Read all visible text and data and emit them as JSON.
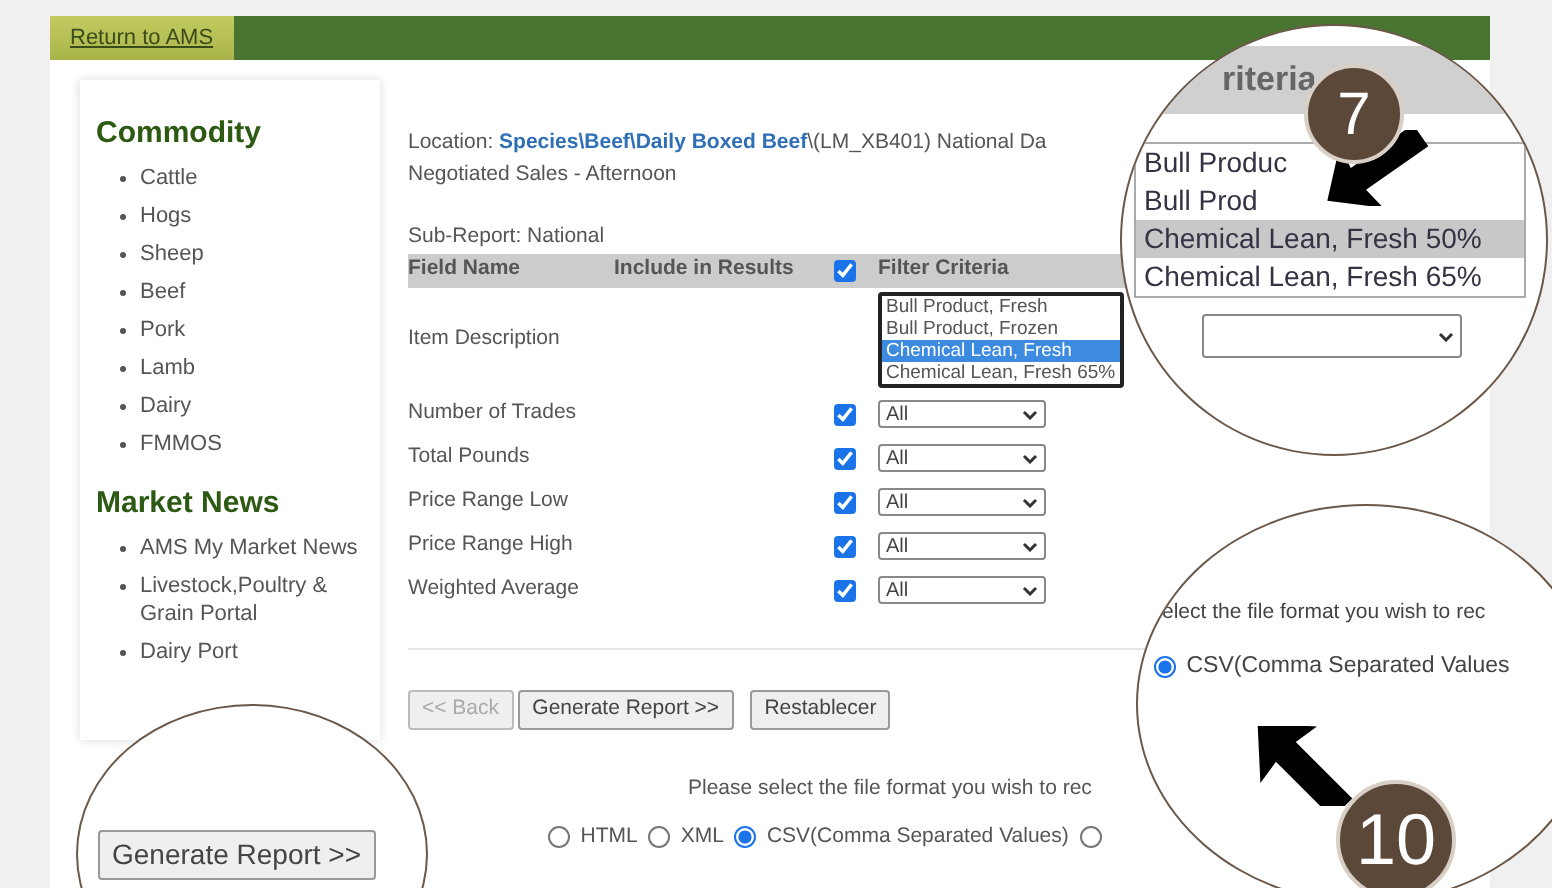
{
  "header": {
    "tab": "Return to AMS"
  },
  "sidebar": {
    "sections": [
      {
        "title": "Commodity",
        "items": [
          "Cattle",
          "Hogs",
          "Sheep",
          "Beef",
          "Pork",
          "Lamb",
          "Dairy",
          "FMMOS"
        ]
      },
      {
        "title": "Market News",
        "items": [
          "AMS My Market News",
          "Livestock,Poultry & Grain Portal",
          "Dairy Port"
        ]
      }
    ]
  },
  "location": {
    "text": "Location: **Species\\Beef\\Daily Boxed Beef**\\(LM_XB401) National Da",
    "line2": "Negotiated Sales - Afternoon"
  },
  "sub_report": "Sub-Report: National",
  "table": {
    "columns": [
      "Field Name",
      "Include in Results",
      "Filter Criteria"
    ],
    "include_all": true,
    "rows": [
      {
        "kind": "listbox",
        "field": "Item Description",
        "options": [
          {
            "label": "Bull Product, Fresh",
            "selected": false
          },
          {
            "label": "Bull Product, Frozen",
            "selected": false
          },
          {
            "label": "Chemical Lean, Fresh",
            "selected": true
          },
          {
            "label": "Chemical Lean, Fresh 65%",
            "selected": false
          }
        ]
      },
      {
        "kind": "dropdown",
        "field": "Number of Trades",
        "checked": true,
        "value": "All"
      },
      {
        "kind": "dropdown",
        "field": "Total Pounds",
        "checked": true,
        "value": "All"
      },
      {
        "kind": "dropdown",
        "field": "Price Range Low",
        "checked": true,
        "value": "All"
      },
      {
        "kind": "dropdown",
        "field": "Price Range High",
        "checked": true,
        "value": "All"
      },
      {
        "kind": "dropdown",
        "field": "Weighted Average",
        "checked": true,
        "value": "All"
      }
    ]
  },
  "buttons": [
    {
      "label": "<< Back",
      "disabled": true
    },
    {
      "label": "Generate Report >>",
      "disabled": false
    },
    {
      "label": "Restablecer",
      "disabled": false
    }
  ],
  "format": {
    "prompt": "Please select the file format you wish to rec",
    "options": [
      {
        "label": "HTML",
        "selected": false
      },
      {
        "label": "XML",
        "selected": false
      },
      {
        "label": "CSV(Comma Separated Values)",
        "selected": true
      },
      {
        "selected": false
      }
    ]
  },
  "callouts": [
    {
      "kind": "listbox",
      "badge": "7",
      "header": "riteria",
      "options": [
        {
          "label": "Bull Produc",
          "selected": false
        },
        {
          "label": "Bull Prod",
          "selected": false
        },
        {
          "label": "Chemical Lean, Fresh 50%",
          "selected": true
        },
        {
          "label": "Chemical Lean, Fresh 65%",
          "selected": false
        }
      ]
    },
    {
      "kind": "button",
      "label": "Generate Report >>"
    },
    {
      "kind": "radio",
      "badge": "10",
      "prompt": "elect the file format you wish to rec",
      "option": {
        "label": "CSV(Comma Separated Values",
        "selected": true
      }
    }
  ]
}
